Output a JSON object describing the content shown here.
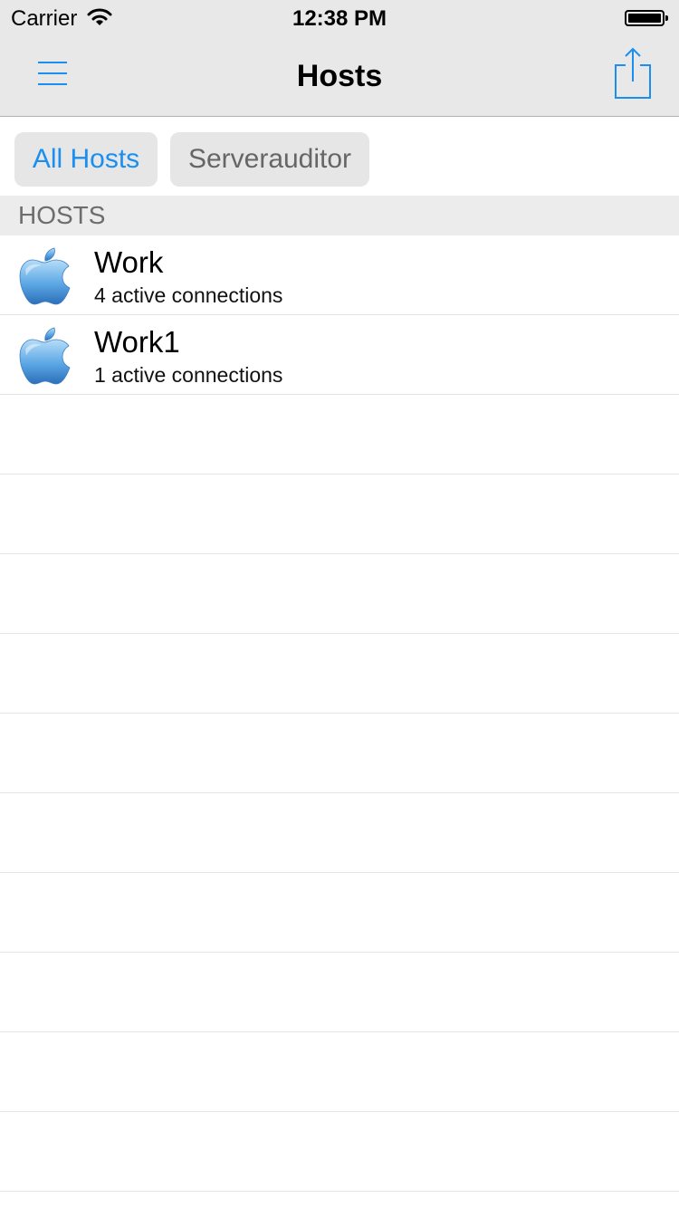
{
  "status_bar": {
    "carrier": "Carrier",
    "time": "12:38 PM",
    "wifi_icon": "wifi-icon",
    "battery_icon": "battery-icon"
  },
  "nav": {
    "title": "Hosts",
    "menu_icon": "hamburger-menu-icon",
    "share_icon": "share-icon",
    "accent_color": "#1a8ff0"
  },
  "filters": [
    {
      "label": "All Hosts",
      "selected": true
    },
    {
      "label": "Serverauditor",
      "selected": false
    }
  ],
  "section": {
    "title": "HOSTS"
  },
  "hosts": [
    {
      "name": "Work",
      "subtitle": "4 active connections",
      "icon": "apple-logo-icon"
    },
    {
      "name": "Work1",
      "subtitle": "1 active connections",
      "icon": "apple-logo-icon"
    }
  ]
}
